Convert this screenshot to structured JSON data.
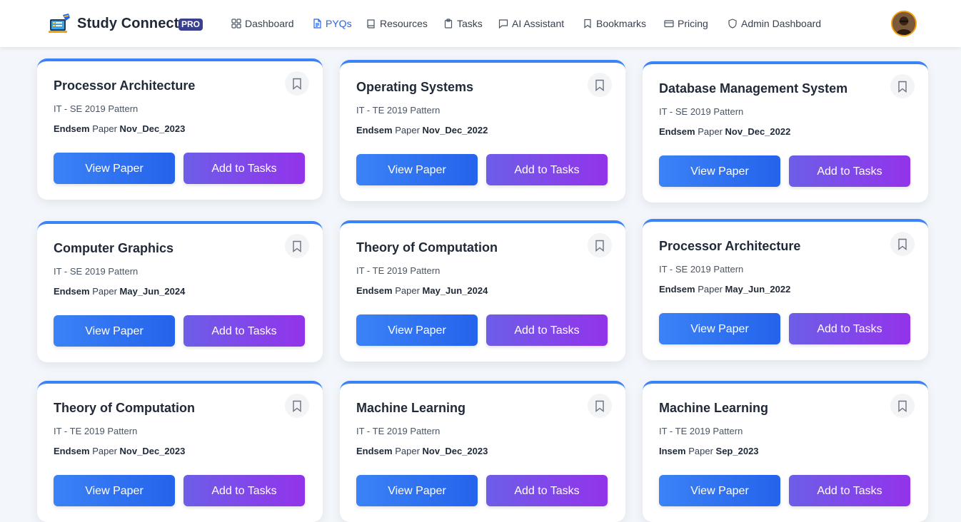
{
  "header": {
    "brand_name": "Study Connect",
    "badge": "PRO",
    "nav": [
      {
        "label": "Dashboard",
        "icon": "grid-icon",
        "active": false
      },
      {
        "label": "PYQs",
        "icon": "file-text-icon",
        "active": true
      },
      {
        "label": "Resources",
        "icon": "book-icon",
        "active": false
      },
      {
        "label": "Tasks",
        "icon": "clipboard-icon",
        "active": false
      },
      {
        "label": "AI Assistant",
        "icon": "chat-icon",
        "active": false
      },
      {
        "label": "Bookmarks",
        "icon": "bookmark-icon",
        "active": false
      },
      {
        "label": "Pricing",
        "icon": "credit-card-icon",
        "active": false
      },
      {
        "label": "Admin Dashboard",
        "icon": "shield-icon",
        "active": false
      }
    ],
    "avatar_alt": "user-avatar"
  },
  "colors": {
    "accent": "#2563eb",
    "card_top_border": "#3b82f6",
    "view_button": "#3b82f6",
    "tasks_button": "#9333ea",
    "background": "#f3f6fa"
  },
  "cards": [
    {
      "title": "Processor Architecture",
      "meta": "IT - SE 2019 Pattern",
      "paper_type": "Endsem",
      "paper_word": "Paper",
      "session": "Nov_Dec_2023",
      "view_label": "View Paper",
      "add_label": "Add to Tasks"
    },
    {
      "title": "Operating Systems",
      "meta": "IT - TE 2019 Pattern",
      "paper_type": "Endsem",
      "paper_word": "Paper",
      "session": "Nov_Dec_2022",
      "view_label": "View Paper",
      "add_label": "Add to Tasks"
    },
    {
      "title": "Database Management System",
      "meta": "IT - SE 2019 Pattern",
      "paper_type": "Endsem",
      "paper_word": "Paper",
      "session": "Nov_Dec_2022",
      "view_label": "View Paper",
      "add_label": "Add to Tasks"
    },
    {
      "title": "Computer Graphics",
      "meta": "IT - SE 2019 Pattern",
      "paper_type": "Endsem",
      "paper_word": "Paper",
      "session": "May_Jun_2024",
      "view_label": "View Paper",
      "add_label": "Add to Tasks"
    },
    {
      "title": "Theory of Computation",
      "meta": "IT - TE 2019 Pattern",
      "paper_type": "Endsem",
      "paper_word": "Paper",
      "session": "May_Jun_2024",
      "view_label": "View Paper",
      "add_label": "Add to Tasks"
    },
    {
      "title": "Processor Architecture",
      "meta": "IT - SE 2019 Pattern",
      "paper_type": "Endsem",
      "paper_word": "Paper",
      "session": "May_Jun_2022",
      "view_label": "View Paper",
      "add_label": "Add to Tasks"
    },
    {
      "title": "Theory of Computation",
      "meta": "IT - TE 2019 Pattern",
      "paper_type": "Endsem",
      "paper_word": "Paper",
      "session": "Nov_Dec_2023",
      "view_label": "View Paper",
      "add_label": "Add to Tasks"
    },
    {
      "title": "Machine Learning",
      "meta": "IT - TE 2019 Pattern",
      "paper_type": "Endsem",
      "paper_word": "Paper",
      "session": "Nov_Dec_2023",
      "view_label": "View Paper",
      "add_label": "Add to Tasks"
    },
    {
      "title": "Machine Learning",
      "meta": "IT - TE 2019 Pattern",
      "paper_type": "Insem",
      "paper_word": "Paper",
      "session": "Sep_2023",
      "view_label": "View Paper",
      "add_label": "Add to Tasks"
    }
  ]
}
